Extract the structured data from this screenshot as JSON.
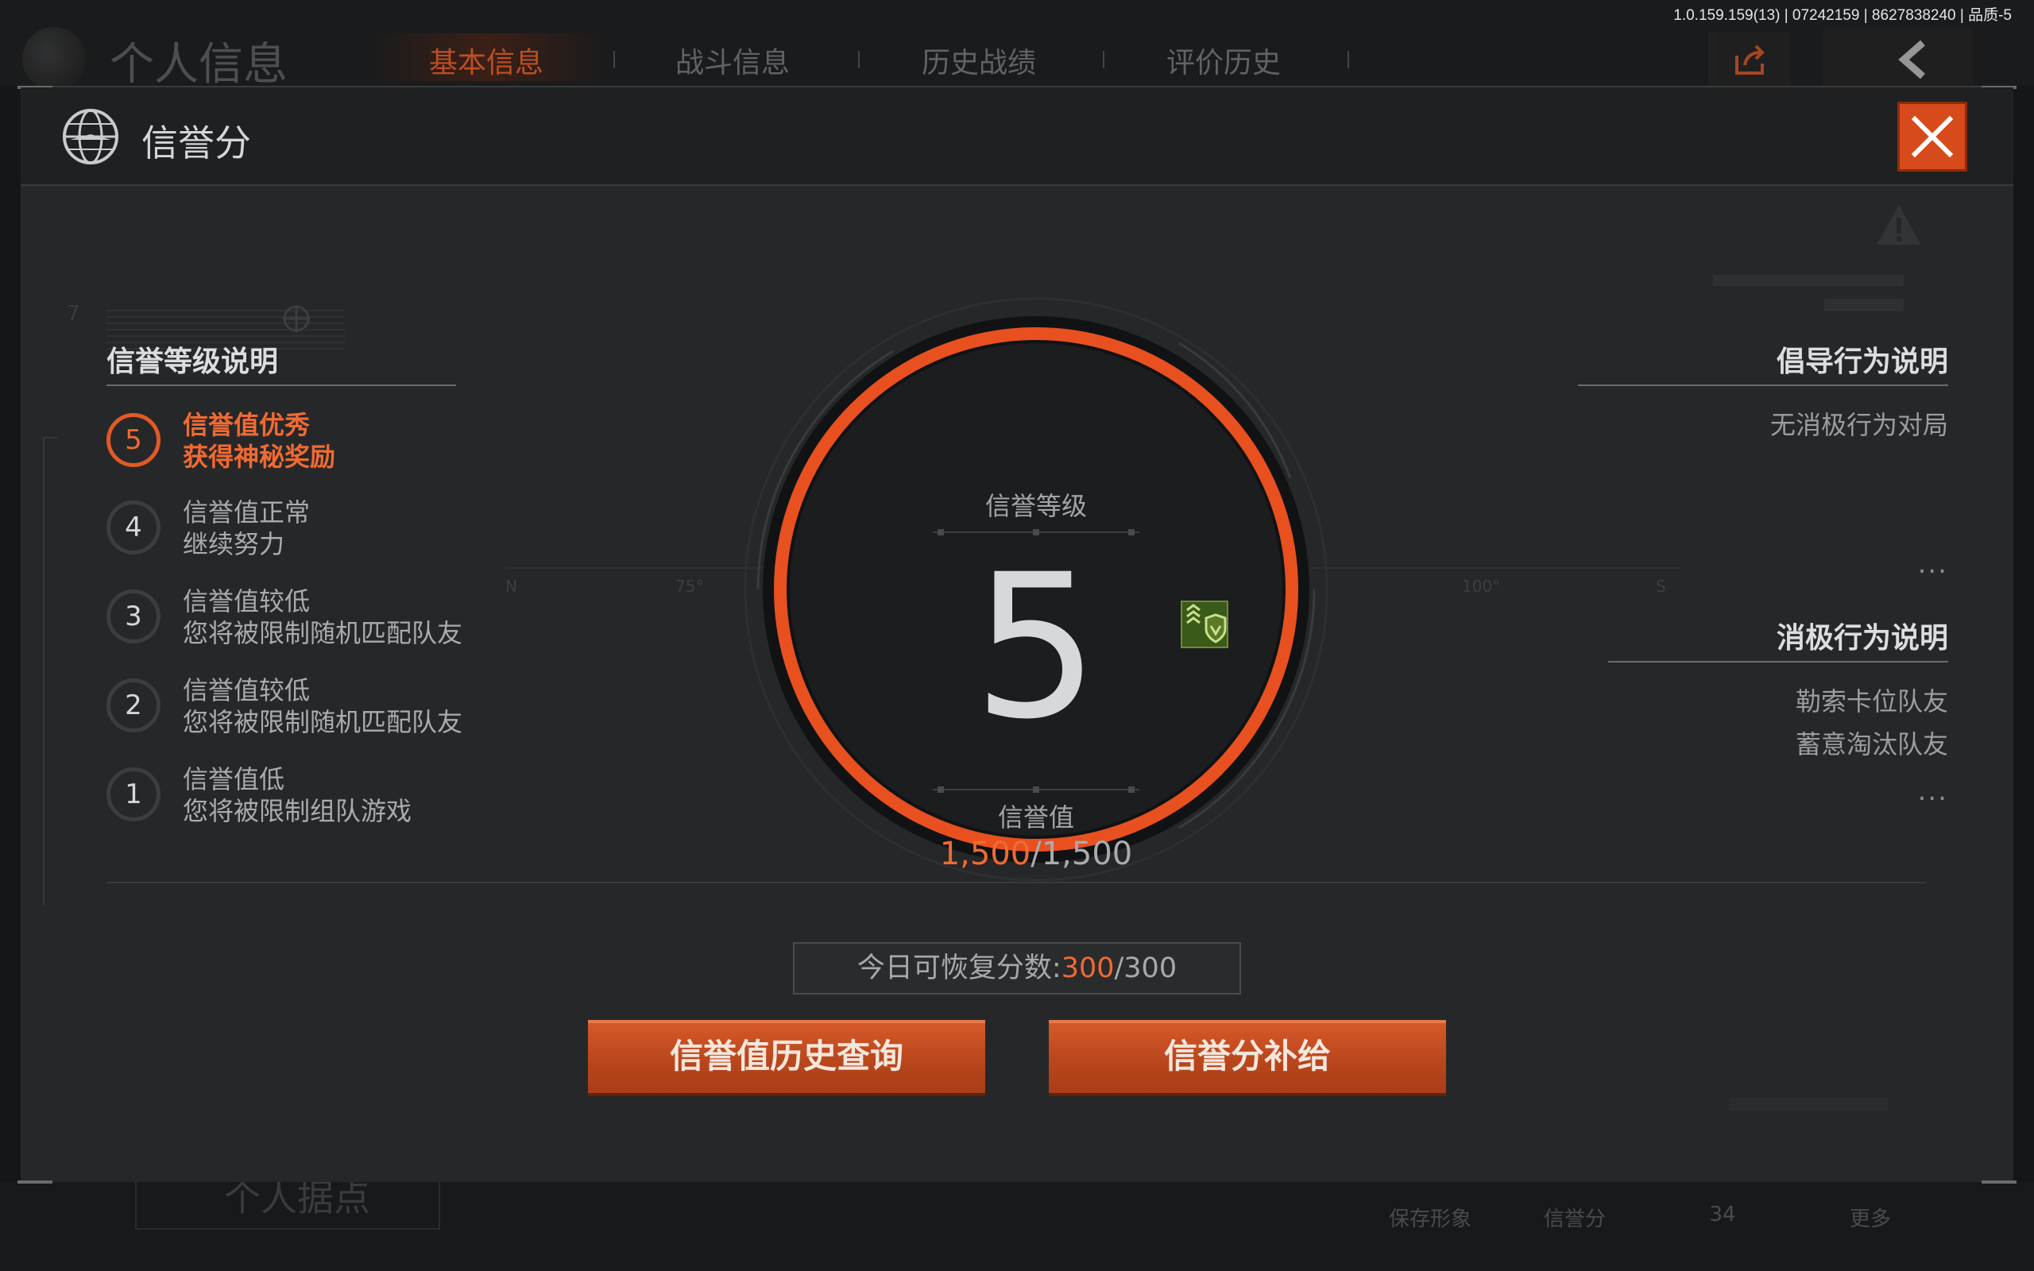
{
  "version": "1.0.159.159(13) | 07242159 | 8627838240 | 品质-5",
  "background": {
    "title": "个人信息",
    "tabs": [
      "基本信息",
      "战斗信息",
      "历史战绩",
      "评价历史"
    ],
    "base_label": "个人据点",
    "bottom_items": [
      "保存形象",
      "信誉分",
      "34",
      "更多"
    ]
  },
  "modal": {
    "title": "信誉分",
    "scale_labels": [
      "7",
      "N",
      "75°",
      "100°",
      "S"
    ],
    "levels_section": {
      "title": "信誉等级说明",
      "items": [
        {
          "num": "5",
          "line1": "信誉值优秀",
          "line2": "获得神秘奖励",
          "active": true
        },
        {
          "num": "4",
          "line1": "信誉值正常",
          "line2": "继续努力",
          "active": false
        },
        {
          "num": "3",
          "line1": "信誉值较低",
          "line2": "您将被限制随机匹配队友",
          "active": false
        },
        {
          "num": "2",
          "line1": "信誉值较低",
          "line2": "您将被限制随机匹配队友",
          "active": false
        },
        {
          "num": "1",
          "line1": "信誉值低",
          "line2": "您将被限制组队游戏",
          "active": false
        }
      ]
    },
    "gauge": {
      "level_label": "信誉等级",
      "level": "5",
      "score_label": "信誉值",
      "score_current": "1,500",
      "score_max": "/1,500",
      "progress": 1.0,
      "ring_color": "#e8501f"
    },
    "promote_section": {
      "title": "倡导行为说明",
      "items": [
        "无消极行为对局"
      ],
      "more": "..."
    },
    "negative_section": {
      "title": "消极行为说明",
      "items": [
        "勒索卡位队友",
        "蓄意淘汰队友"
      ],
      "more": "..."
    },
    "recover": {
      "label": "今日可恢复分数:",
      "current": "300",
      "max": "/300"
    },
    "buttons": {
      "history": "信誉值历史查询",
      "supply": "信誉分补给"
    }
  }
}
